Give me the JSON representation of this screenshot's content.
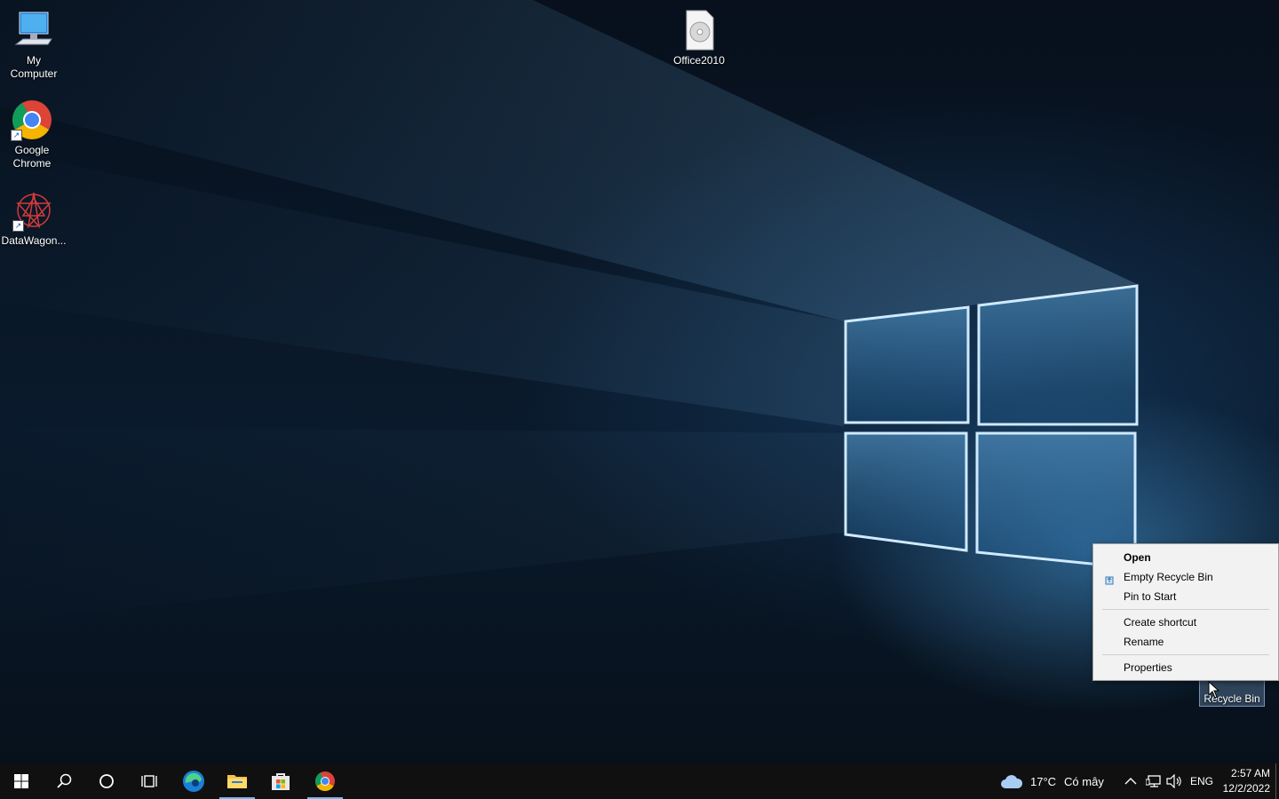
{
  "desktop": {
    "icons": [
      {
        "label": "My\nComputer"
      },
      {
        "label": "Google\nChrome"
      },
      {
        "label": "DataWagon..."
      },
      {
        "label": "Office2010"
      }
    ]
  },
  "context_menu": {
    "items": [
      {
        "label": "Open",
        "bold": true
      },
      {
        "label": "Empty Recycle Bin",
        "icon": "recycle-bin-small-icon"
      },
      {
        "label": "Pin to Start"
      },
      {
        "label": "Create shortcut"
      },
      {
        "label": "Rename"
      },
      {
        "label": "Properties"
      }
    ]
  },
  "recycle_bin": {
    "label": "Recycle Bin"
  },
  "taskbar": {
    "weather_temp": "17°C",
    "weather_desc": "Có mây",
    "language": "ENG",
    "time": "2:57 AM",
    "date": "12/2/2022"
  },
  "colors": {
    "accent": "#76b9ed",
    "taskbar": "#101010",
    "menu_bg": "#f2f2f2"
  }
}
